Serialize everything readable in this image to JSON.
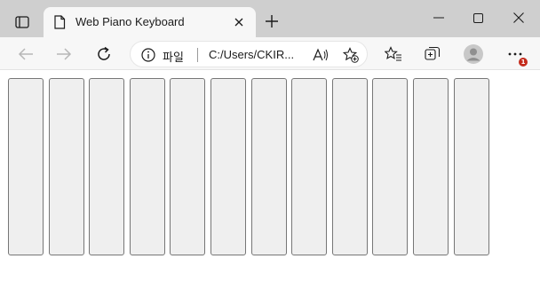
{
  "browser": {
    "tab": {
      "title": "Web Piano Keyboard",
      "favicon": "page-icon"
    },
    "address": {
      "scheme_label": "파일",
      "url": "C:/Users/CKIR..."
    },
    "notification_badge": "1"
  },
  "piano": {
    "key_count": 12,
    "key_color": "#efefef",
    "key_border_color": "#767676"
  },
  "icons": {
    "tab_actions": "tab-actions-icon",
    "close_tab": "close-icon",
    "new_tab": "plus-icon",
    "minimize": "minimize-icon",
    "maximize": "maximize-icon",
    "close_window": "close-icon",
    "back": "back-arrow-icon",
    "forward": "forward-arrow-icon",
    "refresh": "refresh-icon",
    "site_info": "info-icon",
    "read_aloud": "read-aloud-icon",
    "add_favorite": "add-favorite-icon",
    "favorites": "favorites-icon",
    "collections": "collections-icon",
    "profile": "profile-icon",
    "more": "more-icon"
  }
}
